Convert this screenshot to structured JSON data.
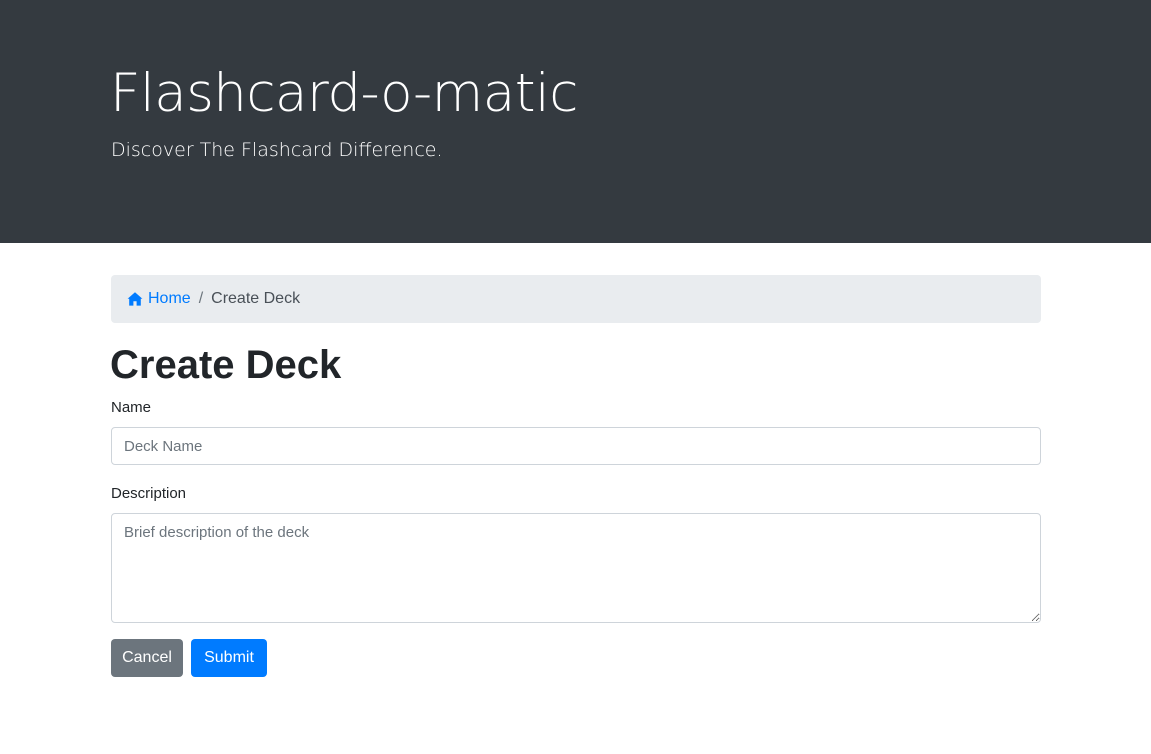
{
  "header": {
    "title": "Flashcard-o-matic",
    "subtitle": "Discover The Flashcard Difference."
  },
  "breadcrumb": {
    "home_icon": "house-icon",
    "home_label": "Home",
    "separator": "/",
    "current": "Create Deck"
  },
  "page": {
    "title": "Create Deck"
  },
  "form": {
    "name_label": "Name",
    "name_value": "",
    "name_placeholder": "Deck Name",
    "description_label": "Description",
    "description_value": "",
    "description_placeholder": "Brief description of the deck",
    "cancel_label": "Cancel",
    "submit_label": "Submit"
  },
  "colors": {
    "header_bg": "#343a40",
    "link": "#007bff",
    "breadcrumb_bg": "#e9ecef",
    "cancel_bg": "#6c757d",
    "submit_bg": "#007bff"
  }
}
